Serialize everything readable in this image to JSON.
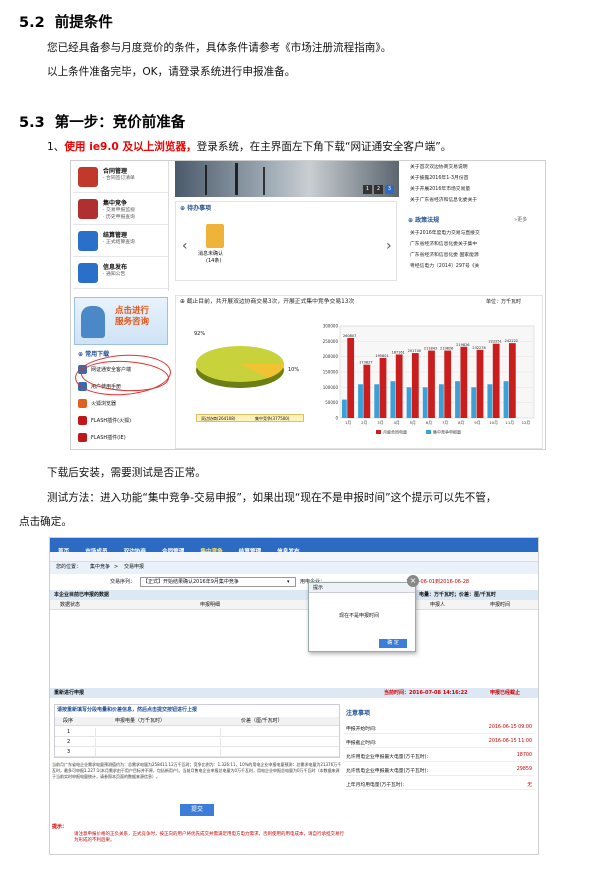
{
  "sec52": {
    "num": "5.2",
    "title": "前提条件",
    "p1": "您已经具备参与月度竞价的条件，具体条件请参考《市场注册流程指南》。",
    "p2": "以上条件准备完毕，OK，请登录系统进行申报准备。"
  },
  "sec53": {
    "num": "5.3",
    "title": "第一步：竞价前准备",
    "step_prefix": "1、",
    "step_red": "使用 ie9.0 及以上浏览器，",
    "step_rest": "登录系统，在主界面左下角下载“网证通安全客户端”。",
    "after1": "下载后安装，需要测试是否正常。",
    "after2a": "测试方法：进入功能“集中竞争-交易申报”，如果出现“现在不是申报时间”这个提示可以先不管，",
    "after2b": "点击确定。"
  },
  "shot1": {
    "menu": [
      {
        "title": "合同管理",
        "sub": [
          "· 合同签订清单"
        ],
        "color": "#c0392b"
      },
      {
        "title": "集中竞争",
        "sub": [
          "· 交易申报监视",
          "· 历史申报查询"
        ],
        "color": "#b03030"
      },
      {
        "title": "结算管理",
        "sub": [
          "· 正式结算查询"
        ],
        "color": "#2a6fc9"
      },
      {
        "title": "信息发布",
        "sub": [
          "· 通知公告"
        ],
        "color": "#2a6fc9"
      }
    ],
    "service": "点击进行\n服务咨询",
    "downloads_title": "常用下载",
    "downloads": [
      "网证通安全客户端",
      "用户使用手册",
      "火狐浏览器",
      "FLASH插件(火狐)",
      "FLASH插件(IE)"
    ],
    "download_colors": [
      "#2f6db5",
      "#2f6db5",
      "#e06020",
      "#c01818",
      "#c01818"
    ],
    "todo_title": "待办事项",
    "todo_item": "消息未确认",
    "todo_count": "(14条)",
    "chart_title": "截止目前，共开展双边协商交易3次，开展正式集中竞争交易13次",
    "unit": "单位：万千瓦时",
    "pie_pcts": [
      "92%",
      "10%"
    ],
    "pie_legend": [
      "双边协商(264108)",
      "集中竞争(377500)"
    ],
    "news_items": [
      "关于首次双边协商交易说明",
      "关于披露2016年1-3月份首",
      "关于开展2016年市场交易量",
      "关于广东省经济和信息化委关于"
    ],
    "slides": [
      "1",
      "2",
      "3"
    ],
    "policy_title": "政策法规",
    "more": "更多",
    "policy_items": [
      "关于2016年度电力交易与直接交",
      "广东省经济和信息化委关于集中",
      "广东省经济和信息化委 国家能源",
      "粤经信电力〔2014〕297号《关"
    ],
    "bar_legend": [
      "月度合同电量",
      "集中竞争申报量"
    ]
  },
  "chart_data": {
    "type": "bar",
    "categories": [
      "1月",
      "2月",
      "3月",
      "4月",
      "5月",
      "6月",
      "7月",
      "8月",
      "9月",
      "10月",
      "11月",
      "12月"
    ],
    "series": [
      {
        "name": "月度合同电量",
        "values": [
          260807,
          173827,
          195801,
          207161,
          211743,
          219826,
          219826,
          232277,
          222251,
          242222,
          244084
        ]
      },
      {
        "name": "集中竞争申报量",
        "values": [
          60000,
          110000,
          110000,
          120000,
          100000,
          100000,
          110000,
          120000,
          100000,
          110000,
          120000
        ]
      }
    ],
    "bar_labels": [
      "260807",
      "173827",
      "195801",
      "187161",
      "201740",
      "211843",
      "219826",
      "219826",
      "232278",
      "222251",
      "242222",
      "244084"
    ],
    "yticks": [
      "300000",
      "250000",
      "200000",
      "150000",
      "100000",
      "50000",
      "0"
    ],
    "ylim": [
      0,
      300000
    ]
  },
  "shot2": {
    "nav": [
      "首页",
      "市场成员",
      "双边协商",
      "合同管理",
      "集中竞争",
      "结算管理",
      "信息发布"
    ],
    "subnav": [
      "交易申报",
      "交易申报",
      "正式结果明细",
      "最低交易申报"
    ],
    "crumb_label": "您的位置：",
    "crumb": [
      "集中竞争",
      ">",
      "交易申报"
    ],
    "period_label": "交易序列：",
    "period_value": "【正式】开始结果确认2016年9月集中竞争",
    "unit_label": "用电企业：",
    "date_range": "2016-06-01到2016-06-28",
    "panel_title": "本企业目前已申报的数据",
    "panel_right": "单位：电量：万千瓦时；价差：厘/千瓦时",
    "cols": [
      "数据状态",
      "申报明细",
      "申报人",
      "申报时间"
    ],
    "dialog_title": "提示",
    "dialog_msg": "现在不是申报时间",
    "dialog_btn": "确 定",
    "declare_title": "重新进行申报",
    "time_label": "当前时间：2016-07-08 14:16:22",
    "time_state": "申报已经截止",
    "fill_title": "请按重新填写分段电量和价差信息，然后点击提交按钮进行上报",
    "tbl_cols": [
      "段序",
      "申报电量（万千瓦时）",
      "价差（厘/千瓦时）"
    ],
    "tbl_rows": [
      "1",
      "2",
      "3"
    ],
    "note_title": "注意事项",
    "notes": [
      {
        "k": "申报开始时间:",
        "v": "2016-06-15 09:00"
      },
      {
        "k": "申报截止时间:",
        "v": "2016-06-15 11:00"
      },
      {
        "k": "允许用电企业申报最大电量(万千瓦时):",
        "v": "18700"
      },
      {
        "k": "允许售电企业申报最大电量(万千瓦时):",
        "v": "29859"
      },
      {
        "k": "上年月均用电量(万千瓦时):",
        "v": "无"
      }
    ],
    "info_text": "当前月广东省电企业需求电量预测值约为：总需求电量为258411.12万千瓦时；竞争比例为：1.326:11，10%的用电企业申报电量预测：总需求电量为21376万千瓦时，最多可申报1.227:1(本月需求由于用户目标并不原，包括新用户)。当前月售电企业申报总电量为0万千瓦时，用电企业申报总电量为0万千瓦时（本数据来源于当前实时申报电量统计，请参照本页面的数据来源信息）。",
    "submit": "提交",
    "tip_title": "提示：",
    "tip_text": "请注意申报价格的正负关系，正式竞争时，按正向的用户将优先成交并需满足用电方电力需求，否则使用的用电成本，请自行承担交易行为形成的不利后果。"
  }
}
